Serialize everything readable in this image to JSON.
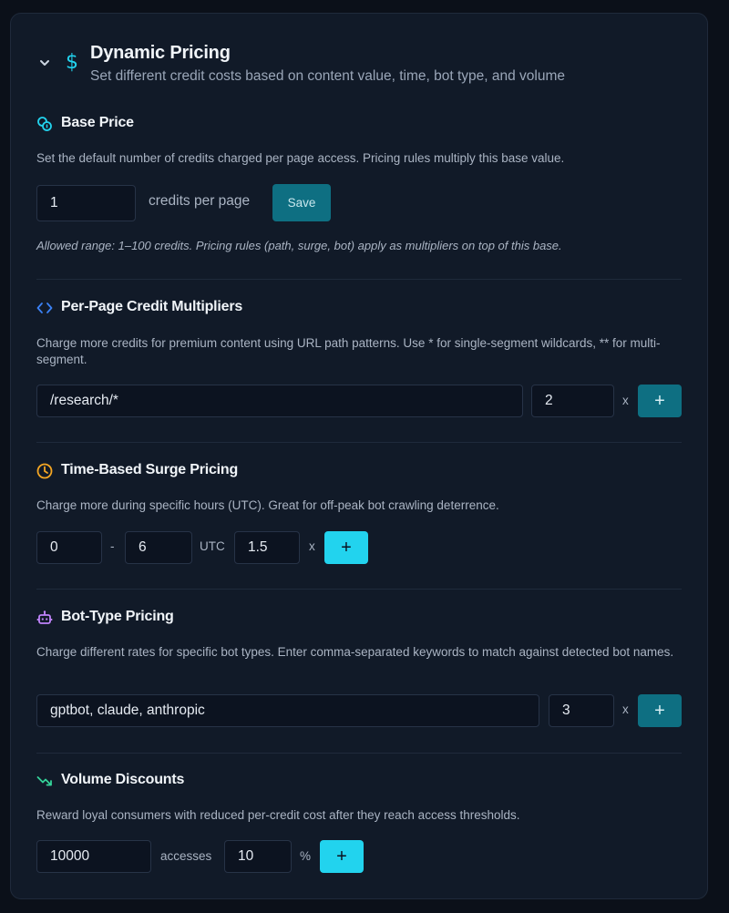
{
  "header": {
    "title": "Dynamic Pricing",
    "subtitle": "Set different credit costs based on content value, time, bot type, and volume",
    "accent": "#22d3ee"
  },
  "base_price": {
    "title": "Base Price",
    "description": "Set the default number of credits charged per page access. Pricing rules multiply this base value.",
    "value": "1",
    "unit_label": "credits per page",
    "save_label": "Save",
    "note": "Allowed range: 1–100 credits. Pricing rules (path, surge, bot) apply as multipliers on top of this base."
  },
  "per_page": {
    "title": "Per-Page Credit Multipliers",
    "description": "Charge more credits for premium content using URL path patterns. Use * for single-segment wildcards, ** for multi-segment.",
    "pattern": "/research/*",
    "multiplier": "2",
    "x_label": "x",
    "add_label": "+"
  },
  "surge": {
    "title": "Time-Based Surge Pricing",
    "description": "Charge more during specific hours (UTC). Great for off-peak bot crawling deterrence.",
    "start": "0",
    "dash": "-",
    "end": "6",
    "utc_label": "UTC",
    "multiplier": "1.5",
    "x_label": "x",
    "add_label": "+"
  },
  "bot_type": {
    "title": "Bot-Type Pricing",
    "description": "Charge different rates for specific bot types. Enter comma-separated keywords to match against detected bot names.",
    "keywords": "gptbot, claude, anthropic",
    "multiplier": "3",
    "x_label": "x",
    "add_label": "+"
  },
  "volume": {
    "title": "Volume Discounts",
    "description": "Reward loyal consumers with reduced per-credit cost after they reach access thresholds.",
    "threshold": "10000",
    "accesses_label": "accesses",
    "discount": "10",
    "percent_label": "%",
    "add_label": "+"
  },
  "colors": {
    "teal_button": "#0e6f82",
    "cyan_button": "#22d3ee",
    "clock_icon": "#f5a623",
    "bot_icon": "#c084fc",
    "trend_icon": "#34d399"
  }
}
